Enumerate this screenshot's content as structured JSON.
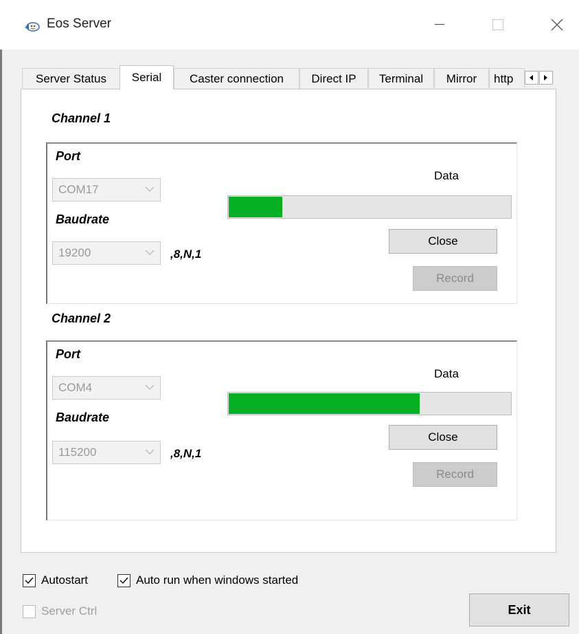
{
  "window": {
    "title": "Eos Server"
  },
  "tabs": [
    {
      "label": "Server Status",
      "active": false
    },
    {
      "label": "Serial",
      "active": true
    },
    {
      "label": "Caster connection",
      "active": false
    },
    {
      "label": "Direct IP",
      "active": false
    },
    {
      "label": "Terminal",
      "active": false
    },
    {
      "label": "Mirror",
      "active": false
    },
    {
      "label": "http",
      "active": false
    }
  ],
  "channels": [
    {
      "title": "Channel 1",
      "port_label": "Port",
      "port_value": "COM17",
      "baudrate_label": "Baudrate",
      "baudrate_value": "19200",
      "suffix": ",8,N,1",
      "data_label": "Data",
      "progress_fraction": 0.19,
      "close_label": "Close",
      "record_label": "Record"
    },
    {
      "title": "Channel 2",
      "port_label": "Port",
      "port_value": "COM4",
      "baudrate_label": "Baudrate",
      "baudrate_value": "115200",
      "suffix": ",8,N,1",
      "data_label": "Data",
      "progress_fraction": 0.675,
      "close_label": "Close",
      "record_label": "Record"
    }
  ],
  "options": {
    "autostart": {
      "label": "Autostart",
      "checked": true
    },
    "autorun": {
      "label": "Auto run when windows started",
      "checked": true
    },
    "server_ctrl": {
      "label": "Server Ctrl",
      "checked": false,
      "enabled": false
    }
  },
  "exit_label": "Exit",
  "colors": {
    "progress_fill": "#06b025",
    "progress_track": "#e6e6e6"
  }
}
